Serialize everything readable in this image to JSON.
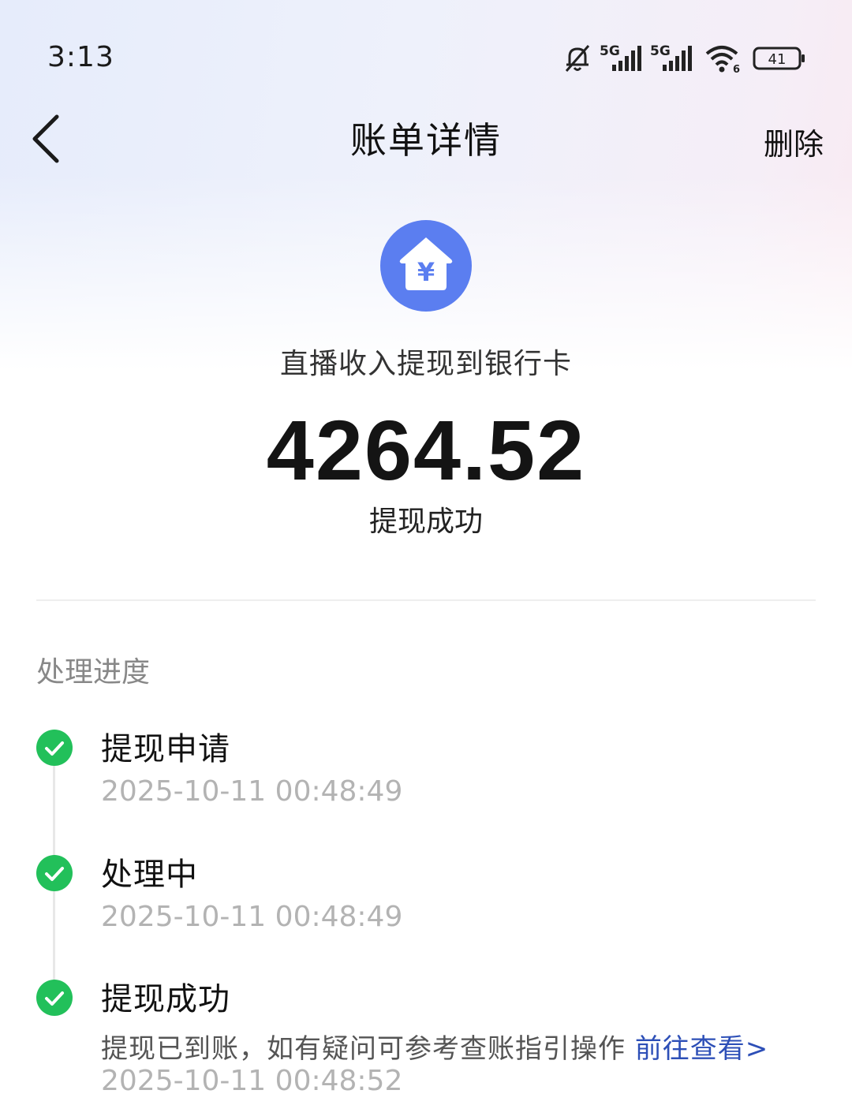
{
  "status_bar": {
    "time": "3:13",
    "icons": [
      "bell-muted-icon",
      "signal-5g-1-icon",
      "signal-5g-2-icon",
      "wifi-6-icon",
      "battery-icon"
    ],
    "signal1_label": "5G",
    "signal2_label": "5G",
    "wifi_label": "6",
    "battery_level": "41"
  },
  "header": {
    "back_icon": "chevron-left-icon",
    "title": "账单详情",
    "delete_label": "删除"
  },
  "summary": {
    "icon": "house-yen-icon",
    "icon_symbol": "¥",
    "icon_color": "#5b7ef0",
    "description": "直播收入提现到银行卡",
    "amount": "4264.52",
    "status": "提现成功"
  },
  "progress": {
    "title": "处理进度",
    "check_color": "#22c05a",
    "steps": [
      {
        "title": "提现申请",
        "time": "2025-10-11 00:48:49"
      },
      {
        "title": "处理中",
        "time": "2025-10-11 00:48:49"
      },
      {
        "title": "提现成功",
        "note": "提现已到账，如有疑问可参考查账指引操作",
        "link": "前往查看>",
        "time": "2025-10-11 00:48:52"
      }
    ]
  }
}
